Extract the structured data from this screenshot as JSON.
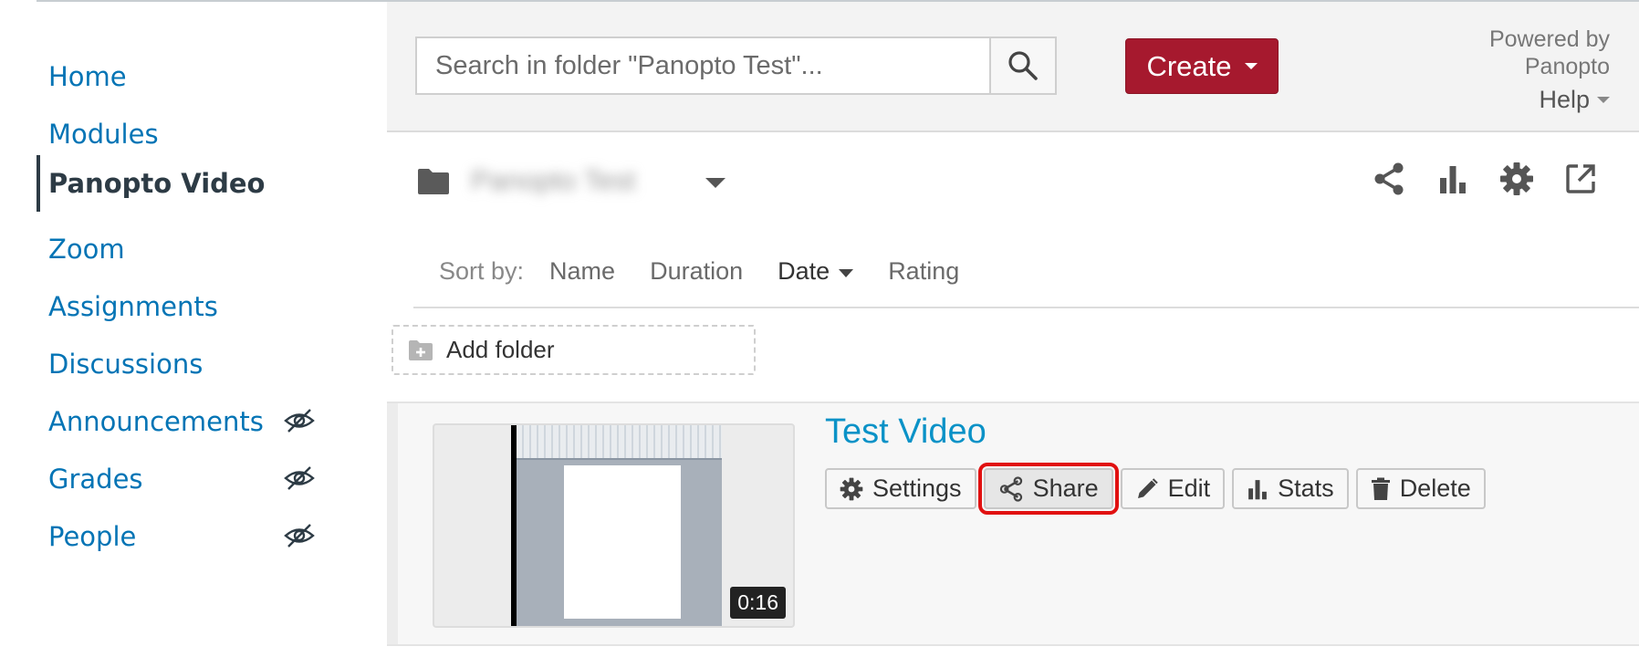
{
  "nav": {
    "items": [
      {
        "label": "Home",
        "hidden": false
      },
      {
        "label": "Modules",
        "hidden": false
      },
      {
        "label": "Panopto Video",
        "hidden": false,
        "active": true
      },
      {
        "label": "Zoom",
        "hidden": false
      },
      {
        "label": "Assignments",
        "hidden": false
      },
      {
        "label": "Discussions",
        "hidden": false
      },
      {
        "label": "Announcements",
        "hidden": true
      },
      {
        "label": "Grades",
        "hidden": true
      },
      {
        "label": "People",
        "hidden": true
      }
    ]
  },
  "header": {
    "search_placeholder": "Search in folder \"Panopto Test\"...",
    "create_label": "Create",
    "powered_line1": "Powered by",
    "powered_line2": "Panopto",
    "help_label": "Help"
  },
  "folder": {
    "name": "Panopto Test",
    "action_icons": [
      "share-icon",
      "stats-icon",
      "gear-icon",
      "open-external-icon"
    ]
  },
  "sort": {
    "label": "Sort by:",
    "options": [
      "Name",
      "Duration",
      "Date",
      "Rating"
    ],
    "active": "Date"
  },
  "add_folder_label": "Add folder",
  "session": {
    "title": "Test Video",
    "duration": "0:16",
    "actions": [
      {
        "label": "Settings",
        "icon": "gear-icon"
      },
      {
        "label": "Share",
        "icon": "share-icon",
        "highlighted": true
      },
      {
        "label": "Edit",
        "icon": "pencil-icon"
      },
      {
        "label": "Stats",
        "icon": "stats-icon"
      },
      {
        "label": "Delete",
        "icon": "trash-icon"
      }
    ]
  },
  "colors": {
    "link": "#0374b5",
    "create_button": "#a6192e",
    "title": "#0a92c7",
    "highlight_box": "#e11111"
  }
}
